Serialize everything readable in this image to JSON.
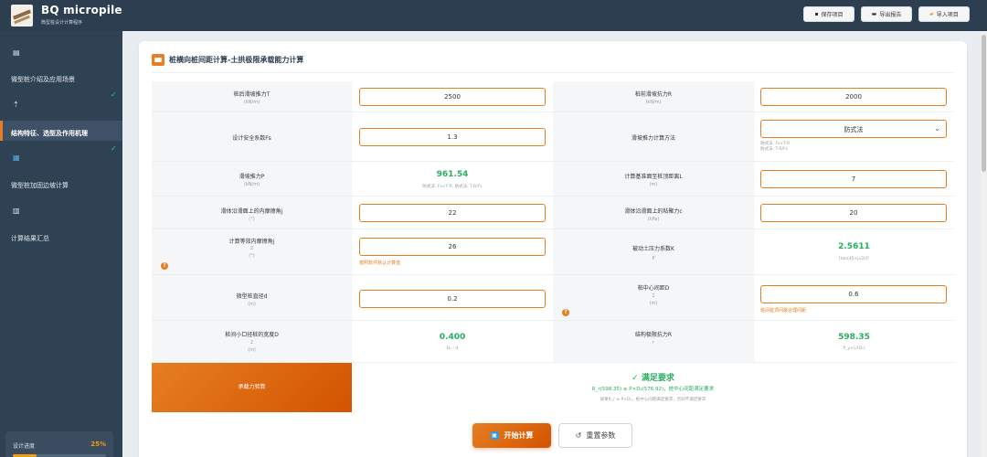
{
  "app": {
    "title": "BQ micropile",
    "subtitle": "微型桩设计计算程序"
  },
  "header_buttons": [
    {
      "icon": "save-icon",
      "glyph": "▪",
      "label": "保存项目"
    },
    {
      "icon": "export-icon",
      "glyph": "▬",
      "label": "导出报告"
    },
    {
      "icon": "folder-icon",
      "glyph": "▰",
      "label": "导入项目"
    }
  ],
  "sidebar": {
    "items": [
      {
        "icon": "document-icon",
        "glyph": "▤",
        "label": "微型桩介绍及应用场景",
        "done": true
      },
      {
        "icon": "chart-up-icon",
        "glyph": "⇡",
        "label": "结构特征、选型及作用机理",
        "done": true,
        "active": true
      },
      {
        "icon": "calculator-icon",
        "glyph": "▦",
        "label": "微型桩加固边坡计算",
        "done": false
      },
      {
        "icon": "bar-chart-icon",
        "glyph": "▥",
        "label": "计算结果汇总",
        "done": false
      }
    ],
    "check_glyph": "✓",
    "progress": {
      "label": "设计进度",
      "value_text": "25%",
      "fraction": 0.25
    }
  },
  "section": {
    "title": "桩横向桩间距计算-土拱极限承载能力计算"
  },
  "table": {
    "rows": [
      {
        "left": {
          "label": "桩后滑坡推力T",
          "unit": "(kN/m)",
          "value": "2500"
        },
        "right": {
          "label": "桩前滑坡抗力R",
          "unit": "(kN/m)",
          "value": "2000"
        }
      },
      {
        "left": {
          "label": "设计安全系数Fs",
          "unit": "",
          "value": "1.3"
        },
        "right": {
          "label": "滑坡推力计算方法",
          "unit": "",
          "value": "防式法",
          "chevron": "⌄",
          "hint1": "防式法: Fs×T-R",
          "hint2": "防式法: T-R/Fs"
        }
      },
      {
        "left": {
          "label": "滑坡推力P",
          "unit": "(kN/m)",
          "value": "961.54",
          "formula": "防式法: Fs×T-R; 防式法: T-R/Fs"
        },
        "right": {
          "label": "计算基准面至桩顶距离L",
          "unit": "(m)",
          "value": "7"
        }
      },
      {
        "left": {
          "label": "滑体沿滑面上的内摩擦角j",
          "unit": "(°)",
          "value": "22"
        },
        "right": {
          "label": "滑体沿滑面上的粘聚力c",
          "unit": "(kPa)",
          "value": "20"
        }
      },
      {
        "left": {
          "label": "计算等效内摩擦角j",
          "unit2": "2",
          "unit": "(°)",
          "value": "26",
          "hint": "按照软件默认计算值"
        },
        "right": {
          "label": "被动土压力系数K",
          "unit": "P",
          "value": "2.5611",
          "formula": "[tan(45+j₂/2)]²"
        }
      },
      {
        "left": {
          "label": "微型桩直径d",
          "unit": "(m)",
          "value": "0.2"
        },
        "right": {
          "label": "桩中心间距D",
          "unit2": "1",
          "unit": "(m)",
          "value": "0.6",
          "hint": "桩间桩顶间最合理间距"
        }
      },
      {
        "left": {
          "label": "桩间小口径桩的宽度D",
          "unit2": "2",
          "unit": "(m)",
          "value": "0.400",
          "formula": "D₁ - d"
        },
        "right": {
          "label": "结构极限抗力R",
          "unit2": "r",
          "unit": "",
          "value": "598.35",
          "formula": "P_y×L/(D₁)"
        }
      }
    ],
    "qmark_glyph": "?"
  },
  "result": {
    "label": "承载力验算",
    "title": "✓ 满足要求",
    "line": "R_r(598.35) ≥ P×D₁(576.92)，桩中心间距满足要求",
    "note": "如果R_r ≥ P×D₁，桩中心间距满足要求，否则不满足要求"
  },
  "actions": {
    "calculate": {
      "icon": "calculator-icon",
      "glyph": "▣",
      "label": "开始计算"
    },
    "reset": {
      "icon": "reset-icon",
      "glyph": "↺",
      "label": "重置参数"
    }
  },
  "colors": {
    "accent": "#e67e22",
    "header_bg": "#2c3e50",
    "sidebar_bg": "#2f4254",
    "success": "#27ae60"
  }
}
